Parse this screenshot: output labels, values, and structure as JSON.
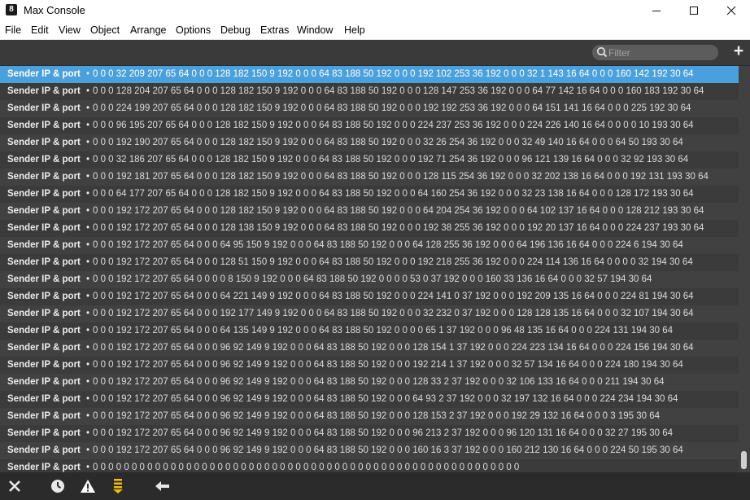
{
  "window": {
    "title": "Max Console",
    "app_icon_glyph": "8",
    "minimize_glyph": "—",
    "maximize_glyph": "☐",
    "close_glyph": "✕"
  },
  "menu": [
    "File",
    "Edit",
    "View",
    "Object",
    "Arrange",
    "Options",
    "Debug",
    "Extras",
    "Window",
    "Help"
  ],
  "toolbar": {
    "filter_placeholder": "Filter",
    "add_glyph": "+"
  },
  "colors": {
    "accent": "#4aa0dc",
    "warning": "#ffffff",
    "levels_icon": "#f0c000"
  },
  "console": {
    "sender_label": "Sender IP & port",
    "bullet": "•",
    "rows": [
      {
        "msg": "0 0 0 32 209 207 65 64 0 0 0 128 182 150 9 192 0 0 0 64 83 188 50 192 0 0 0 192 102 253 36 192 0 0 0 32 1 143 16 64 0 0 0 160 142 192 30 64"
      },
      {
        "msg": "0 0 0 128 204 207 65 64 0 0 0 128 182 150 9 192 0 0 0 64 83 188 50 192 0 0 0 128 147 253 36 192 0 0 0 64 77 142 16 64 0 0 0 160 183 192 30 64"
      },
      {
        "msg": "0 0 0 224 199 207 65 64 0 0 0 128 182 150 9 192 0 0 0 64 83 188 50 192 0 0 0 192 192 253 36 192 0 0 0 64 151 141 16 64 0 0 0 225 192 30 64"
      },
      {
        "msg": "0 0 0 96 195 207 65 64 0 0 0 128 182 150 9 192 0 0 0 64 83 188 50 192 0 0 0 224 237 253 36 192 0 0 0 224 226 140 16 64 0 0 0 0 10 193 30 64"
      },
      {
        "msg": "0 0 0 192 190 207 65 64 0 0 0 128 182 150 9 192 0 0 0 64 83 188 50 192 0 0 0 32 26 254 36 192 0 0 0 32 49 140 16 64 0 0 0 64 50 193 30 64"
      },
      {
        "msg": "0 0 0 32 186 207 65 64 0 0 0 128 182 150 9 192 0 0 0 64 83 188 50 192 0 0 0 192 71 254 36 192 0 0 0 96 121 139 16 64 0 0 0 32 92 193 30 64"
      },
      {
        "msg": "0 0 0 192 181 207 65 64 0 0 0 128 182 150 9 192 0 0 0 64 83 188 50 192 0 0 0 128 115 254 36 192 0 0 0 32 202 138 16 64 0 0 0 192 131 193 30 64"
      },
      {
        "msg": "0 0 0 64 177 207 65 64 0 0 0 128 182 150 9 192 0 0 0 64 83 188 50 192 0 0 0 64 160 254 36 192 0 0 0 32 23 138 16 64 0 0 0 128 172 193 30 64"
      },
      {
        "msg": "0 0 0 192 172 207 65 64 0 0 0 128 182 150 9 192 0 0 0 64 83 188 50 192 0 0 0 64 204 254 36 192 0 0 0 64 102 137 16 64 0 0 0 128 212 193 30 64"
      },
      {
        "msg": "0 0 0 192 172 207 65 64 0 0 0 128 138 150 9 192 0 0 0 64 83 188 50 192 0 0 0 192 38 255 36 192 0 0 0 192 20 137 16 64 0 0 0 224 237 193 30 64"
      },
      {
        "msg": "0 0 0 192 172 207 65 64 0 0 0 64 95 150 9 192 0 0 0 64 83 188 50 192 0 0 0 64 128 255 36 192 0 0 0 64 196 136 16 64 0 0 0 224 6 194 30 64"
      },
      {
        "msg": "0 0 0 192 172 207 65 64 0 0 0 128 51 150 9 192 0 0 0 64 83 188 50 192 0 0 0 192 218 255 36 192 0 0 0 224 114 136 16 64 0 0 0 0 32 194 30 64"
      },
      {
        "msg": "0 0 0 192 172 207 65 64 0 0 0 0 8 150 9 192 0 0 0 64 83 188 50 192 0 0 0 0 53 0 37 192 0 0 0 160 33 136 16 64 0 0 0 32 57 194 30 64"
      },
      {
        "msg": "0 0 0 192 172 207 65 64 0 0 0 64 221 149 9 192 0 0 0 64 83 188 50 192 0 0 0 224 141 0 37 192 0 0 0 192 209 135 16 64 0 0 0 224 81 194 30 64"
      },
      {
        "msg": "0 0 0 192 172 207 65 64 0 0 0 192 177 149 9 192 0 0 0 64 83 188 50 192 0 0 0 32 232 0 37 192 0 0 0 128 128 135 16 64 0 0 0 32 107 194 30 64"
      },
      {
        "msg": "0 0 0 192 172 207 65 64 0 0 0 64 135 149 9 192 0 0 0 64 83 188 50 192 0 0 0 0 65 1 37 192 0 0 0 96 48 135 16 64 0 0 0 224 131 194 30 64"
      },
      {
        "msg": "0 0 0 192 172 207 65 64 0 0 0 96 92 149 9 192 0 0 0 64 83 188 50 192 0 0 0 128 154 1 37 192 0 0 0 224 223 134 16 64 0 0 0 224 156 194 30 64"
      },
      {
        "msg": "0 0 0 192 172 207 65 64 0 0 0 96 92 149 9 192 0 0 0 64 83 188 50 192 0 0 0 192 214 1 37 192 0 0 0 32 57 134 16 64 0 0 0 224 180 194 30 64"
      },
      {
        "msg": "0 0 0 192 172 207 65 64 0 0 0 96 92 149 9 192 0 0 0 64 83 188 50 192 0 0 0 128 33 2 37 192 0 0 0 32 106 133 16 64 0 0 0 211 194 30 64"
      },
      {
        "msg": "0 0 0 192 172 207 65 64 0 0 0 96 92 149 9 192 0 0 0 64 83 188 50 192 0 0 0 64 93 2 37 192 0 0 0 32 197 132 16 64 0 0 0 224 234 194 30 64"
      },
      {
        "msg": "0 0 0 192 172 207 65 64 0 0 0 96 92 149 9 192 0 0 0 64 83 188 50 192 0 0 0 128 153 2 37 192 0 0 0 192 29 132 16 64 0 0 0 3 195 30 64"
      },
      {
        "msg": "0 0 0 192 172 207 65 64 0 0 0 96 92 149 9 192 0 0 0 64 83 188 50 192 0 0 0 96 213 2 37 192 0 0 0 96 120 131 16 64 0 0 0 32 27 195 30 64"
      },
      {
        "msg": "0 0 0 192 172 207 65 64 0 0 0 96 92 149 9 192 0 0 0 64 83 188 50 192 0 0 0 160 16 3 37 192 0 0 0 160 212 130 16 64 0 0 0 224 50 195 30 64"
      },
      {
        "msg": "0 0 0 0 0 0 0 0 0 0 0 0 0 0 0 0 0 0 0 0 0 0 0 0 0 0 0 0 0 0 0 0 0 0 0 0 0 0 0 0 0 0 0 0 0 0 0 0 0 0 0 0 0 0 0"
      }
    ]
  },
  "bottom_bar": {
    "icons": [
      "clear-icon",
      "clock-icon",
      "warning-icon",
      "levels-icon",
      "back-arrow-icon"
    ]
  }
}
